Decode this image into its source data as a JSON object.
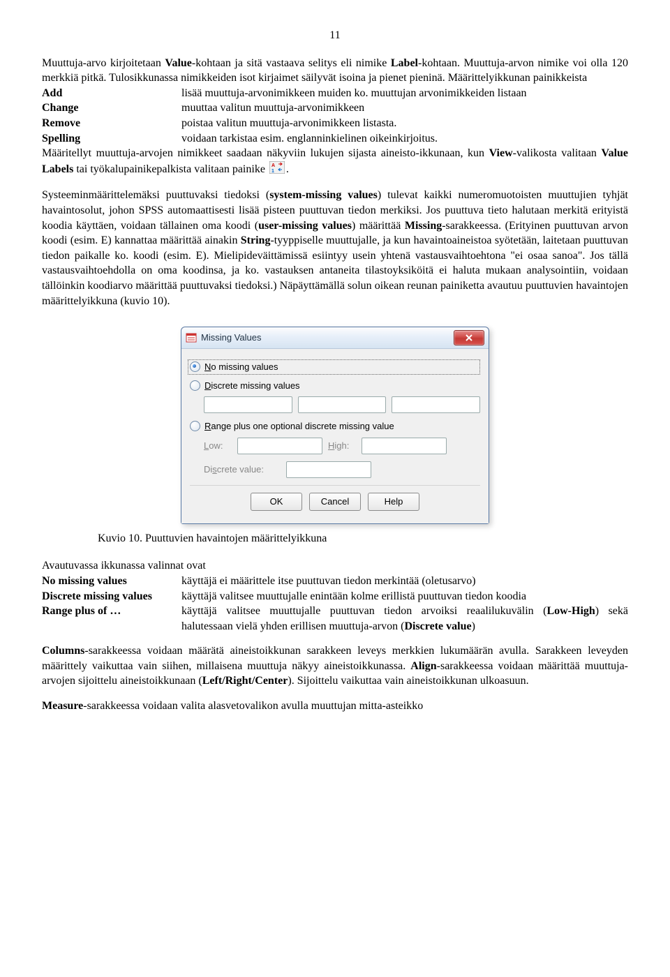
{
  "page_number": "11",
  "para1_a": "Muuttuja-arvo kirjoitetaan ",
  "para1_b": "Value",
  "para1_c": "-kohtaan ja sitä vastaava selitys eli nimike ",
  "para1_d": "Label",
  "para1_e": "-kohtaan. Muuttuja-arvon nimike voi olla 120 merkkiä pitkä. Tulosikkunassa nimikkeiden isot kirjaimet säilyvät isoina ja pienet pieninä.  Määrittelyikkunan painikkeista",
  "defs": {
    "add_t": "Add",
    "add_d": "lisää muuttuja-arvonimikkeen muiden ko. muuttujan  arvonimikkeiden listaan",
    "change_t": "Change",
    "change_d": "muuttaa valitun muuttuja-arvonimikkeen",
    "remove_t": "Remove",
    "remove_d": "poistaa valitun muuttuja-arvonimikkeen listasta.",
    "spelling_t": "Spelling",
    "spelling_d": "voidaan tarkistaa esim. englanninkielinen oikeinkirjoitus."
  },
  "para2_a": "Määritellyt muuttuja-arvojen nimikkeet saadaan näkyviin lukujen sijasta aineisto-ikkunaan, kun ",
  "para2_b": "View",
  "para2_c": "-valikosta valitaan ",
  "para2_d": "Value Labels",
  "para2_e": " tai työkalupainikepalkista valitaan painike ",
  "para2_f": ".",
  "para3_a": "Systeeminmäärittelemäksi puuttuvaksi tiedoksi (",
  "para3_b": "system-missing values",
  "para3_c": ") tulevat kaikki numeromuotoisten muuttujien tyhjät havaintosolut, johon SPSS automaattisesti lisää pisteen puuttuvan tiedon merkiksi. Jos puuttuva tieto halutaan merkitä erityistä koodia käyttäen, voidaan tällainen oma koodi (",
  "para3_d": "user-missing values",
  "para3_e": ") määrittää ",
  "para3_f": "Missing",
  "para3_g": "-sarakkeessa. (Erityinen puuttuvan arvon koodi (esim. E) kannattaa määrittää ainakin ",
  "para3_h": "String",
  "para3_i": "-tyyppiselle muuttujalle, ja kun havaintoaineistoa syötetään, laitetaan puuttuvan tiedon paikalle ko. koodi (esim. E). Mielipideväittämissä esiintyy usein yhtenä vastausvaihtoehtona \"ei osaa sanoa\". Jos tällä vastausvaihtoehdolla on oma koodinsa, ja ko. vastauksen antaneita tilastoyksiköitä ei haluta mukaan analysointiin, voidaan tällöinkin koodiarvo määrittää puuttuvaksi tiedoksi.) Näpäyttämällä solun oikean reunan painiketta avautuu puuttuvien havaintojen määrittelyikkuna (kuvio 10).",
  "dialog": {
    "title": "Missing Values",
    "opt1_pre": "N",
    "opt1_rest": "o missing values",
    "opt2_pre": "D",
    "opt2_rest": "iscrete missing values",
    "opt3_pre": "R",
    "opt3_rest": "ange plus one optional discrete missing value",
    "low_pre": "L",
    "low_rest": "ow:",
    "high_pre": "H",
    "high_rest": "igh:",
    "discrete_rest": "Di",
    "discrete_pre": "s",
    "discrete_rest2": "crete value:",
    "ok": "OK",
    "cancel": "Cancel",
    "help": "Help"
  },
  "caption": "Kuvio 10. Puuttuvien havaintojen määrittelyikkuna",
  "para4": "Avautuvassa ikkunassa valinnat ovat",
  "defs2": {
    "nmv_t": "No missing values",
    "nmv_d": "käyttäjä ei määrittele itse puuttuvan tiedon merkintää (oletusarvo)",
    "dmv_t": "Discrete missing values",
    "dmv_d": "käyttäjä valitsee muuttujalle enintään kolme erillistä puuttuvan tiedon koodia",
    "rpo_t": "Range plus of …",
    "rpo_d_a": "käyttäjä valitsee muuttujalle puuttuvan tiedon arvoiksi reaalilukuvälin (",
    "rpo_d_b": "Low-High",
    "rpo_d_c": ") sekä halutessaan vielä yhden erillisen muuttuja-arvon (",
    "rpo_d_d": "Discrete value",
    "rpo_d_e": ")"
  },
  "para5_a": "Columns",
  "para5_b": "-sarakkeessa voidaan määrätä aineistoikkunan sarakkeen leveys merkkien lukumäärän avulla. Sarakkeen leveyden määrittely vaikuttaa vain siihen, millaisena muuttuja näkyy aineistoikkunassa. ",
  "para5_c": "Align",
  "para5_d": "-sarakkeessa voidaan määrittää muuttuja-arvojen sijoittelu aineistoikkunaan (",
  "para5_e": "Left/Right/Center",
  "para5_f": "). Sijoittelu vaikuttaa vain aineistoikkunan ulkoasuun.",
  "para6_a": "Measure",
  "para6_b": "-sarakkeessa voidaan valita alasvetovalikon avulla muuttujan mitta-asteikko"
}
